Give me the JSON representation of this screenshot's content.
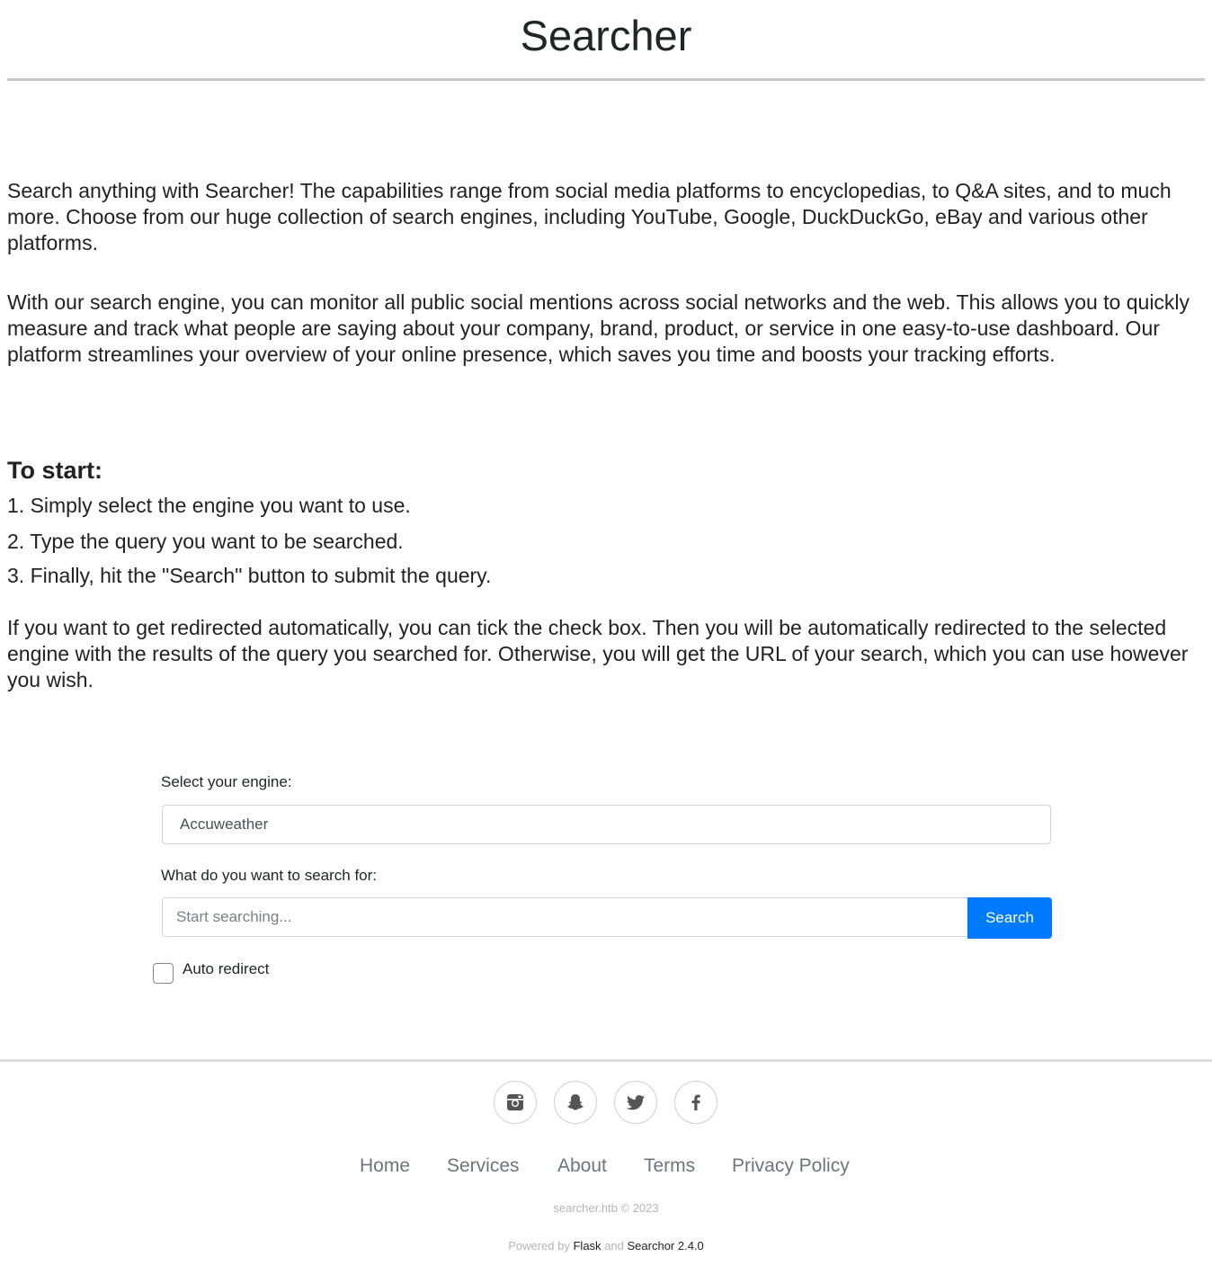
{
  "header": {
    "title": "Searcher"
  },
  "intro": {
    "paragraph1": "Search anything with Searcher! The capabilities range from social media platforms to encyclopedias, to Q&A sites, and to much more. Choose from our huge collection of search engines, including YouTube, Google, DuckDuckGo, eBay and various other platforms.",
    "paragraph2": "With our search engine, you can monitor all public social mentions across social networks and the web. This allows you to quickly measure and track what people are saying about your company, brand, product, or service in one easy-to-use dashboard. Our platform streamlines your overview of your online presence, which saves you time and boosts your tracking efforts."
  },
  "instructions": {
    "heading": "To start:",
    "steps": [
      "1. Simply select the engine you want to use.",
      "2. Type the query you want to be searched.",
      "3. Finally, hit the \"Search\" button to submit the query."
    ],
    "redirect_note": "If you want to get redirected automatically, you can tick the check box. Then you will be automatically redirected to the selected engine with the results of the query you searched for. Otherwise, you will get the URL of your search, which you can use however you wish."
  },
  "form": {
    "engine_label": "Select your engine:",
    "engine_value": "Accuweather",
    "query_label": "What do you want to search for:",
    "query_placeholder": "Start searching...",
    "query_value": "",
    "search_button": "Search",
    "auto_redirect_label": "Auto redirect",
    "auto_redirect_checked": false,
    "accent_color": "#007bff"
  },
  "footer": {
    "social_icons": [
      "instagram-icon",
      "snapchat-icon",
      "twitter-icon",
      "facebook-icon"
    ],
    "nav": [
      "Home",
      "Services",
      "About",
      "Terms",
      "Privacy Policy"
    ],
    "copyright": "searcher.htb © 2023",
    "powered_prefix": "Powered by",
    "powered_flask": "Flask",
    "powered_and": "and",
    "powered_searchor": "Searchor 2.4.0"
  }
}
